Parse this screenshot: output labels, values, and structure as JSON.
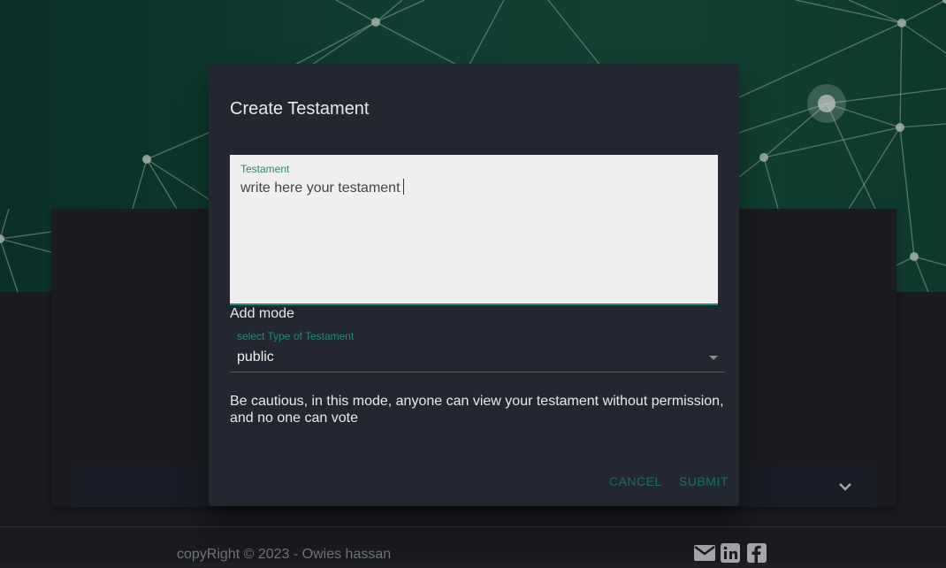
{
  "dialog": {
    "title": "Create Testament",
    "textarea": {
      "label": "Testament",
      "value": "write here your testament"
    },
    "add_mode_label": "Add mode",
    "select": {
      "label": "select Type of Testament",
      "value": "public"
    },
    "warning": "Be cautious, in this mode, anyone can view your testament without permission, and no one can vote",
    "buttons": {
      "cancel": "CANCEL",
      "submit": "SUBMIT"
    }
  },
  "footer": {
    "copyright": "copyRight © 2023 - Owies hassan",
    "social_icons": [
      "mail-icon",
      "linkedin-icon",
      "facebook-icon"
    ]
  },
  "colors": {
    "accent": "#1f8a78",
    "dialog_bg": "#232731",
    "hero_bg": "#154a3d"
  }
}
